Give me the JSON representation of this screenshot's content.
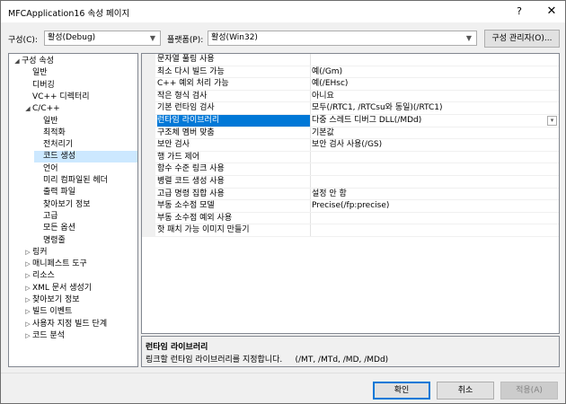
{
  "window": {
    "title": "MFCApplication16 속성 페이지",
    "help_icon": "?",
    "close_icon": "✕"
  },
  "config": {
    "config_label": "구성(C):",
    "config_value": "활성(Debug)",
    "platform_label": "플랫폼(P):",
    "platform_value": "활성(Win32)",
    "manager_button": "구성 관리자(O)..."
  },
  "tree": {
    "items": [
      {
        "label": "구성 속성",
        "toggle": "◢",
        "level": 0
      },
      {
        "label": "일반",
        "toggle": "",
        "level": 1
      },
      {
        "label": "디버깅",
        "toggle": "",
        "level": 1
      },
      {
        "label": "VC++ 디렉터리",
        "toggle": "",
        "level": 1
      },
      {
        "label": "C/C++",
        "toggle": "◢",
        "level": 1
      },
      {
        "label": "일반",
        "toggle": "",
        "level": 2
      },
      {
        "label": "최적화",
        "toggle": "",
        "level": 2
      },
      {
        "label": "전처리기",
        "toggle": "",
        "level": 2
      },
      {
        "label": "코드 생성",
        "toggle": "",
        "level": 2,
        "selected": true
      },
      {
        "label": "언어",
        "toggle": "",
        "level": 2
      },
      {
        "label": "미리 컴파일된 헤더",
        "toggle": "",
        "level": 2
      },
      {
        "label": "출력 파일",
        "toggle": "",
        "level": 2
      },
      {
        "label": "찾아보기 정보",
        "toggle": "",
        "level": 2
      },
      {
        "label": "고급",
        "toggle": "",
        "level": 2
      },
      {
        "label": "모든 옵션",
        "toggle": "",
        "level": 2
      },
      {
        "label": "명령줄",
        "toggle": "",
        "level": 2
      },
      {
        "label": "링커",
        "toggle": "▷",
        "level": 1
      },
      {
        "label": "매니페스트 도구",
        "toggle": "▷",
        "level": 1
      },
      {
        "label": "리소스",
        "toggle": "▷",
        "level": 1
      },
      {
        "label": "XML 문서 생성기",
        "toggle": "▷",
        "level": 1
      },
      {
        "label": "찾아보기 정보",
        "toggle": "▷",
        "level": 1
      },
      {
        "label": "빌드 이벤트",
        "toggle": "▷",
        "level": 1
      },
      {
        "label": "사용자 지정 빌드 단계",
        "toggle": "▷",
        "level": 1
      },
      {
        "label": "코드 분석",
        "toggle": "▷",
        "level": 1
      }
    ]
  },
  "props": {
    "rows": [
      {
        "name": "문자열 풀링 사용",
        "value": ""
      },
      {
        "name": "최소 다시 빌드 가능",
        "value": "예(/Gm)"
      },
      {
        "name": "C++ 예외 처리 가능",
        "value": "예(/EHsc)"
      },
      {
        "name": "작은 형식 검사",
        "value": "아니요"
      },
      {
        "name": "기본 런타임 검사",
        "value": "모두(/RTC1, /RTCsu와 동일)(/RTC1)"
      },
      {
        "name": "런타임 라이브러리",
        "value": "다중 스레드 디버그 DLL(/MDd)",
        "selected": true,
        "dropdown": "▾"
      },
      {
        "name": "구조체 멤버 맞춤",
        "value": "기본값"
      },
      {
        "name": "보안 검사",
        "value": "보안 검사 사용(/GS)"
      },
      {
        "name": "행 가드 제어",
        "value": ""
      },
      {
        "name": "함수 수준 링크 사용",
        "value": ""
      },
      {
        "name": "병렬 코드 생성 사용",
        "value": ""
      },
      {
        "name": "고급 명령 집합 사용",
        "value": "설정 안 함"
      },
      {
        "name": "부동 소수점 모델",
        "value": "Precise(/fp:precise)"
      },
      {
        "name": "부동 소수점 예외 사용",
        "value": ""
      },
      {
        "name": "핫 패치 가능 이미지 만들기",
        "value": ""
      }
    ]
  },
  "description": {
    "title": "런타임 라이브러리",
    "text": "링크할 런타임 라이브러리를 지정합니다.     (/MT, /MTd, /MD, /MDd)"
  },
  "buttons": {
    "ok": "확인",
    "cancel": "취소",
    "apply": "적용(A)"
  },
  "colors": {
    "selection_blue": "#0078d7",
    "tree_selected": "#cce8ff"
  }
}
